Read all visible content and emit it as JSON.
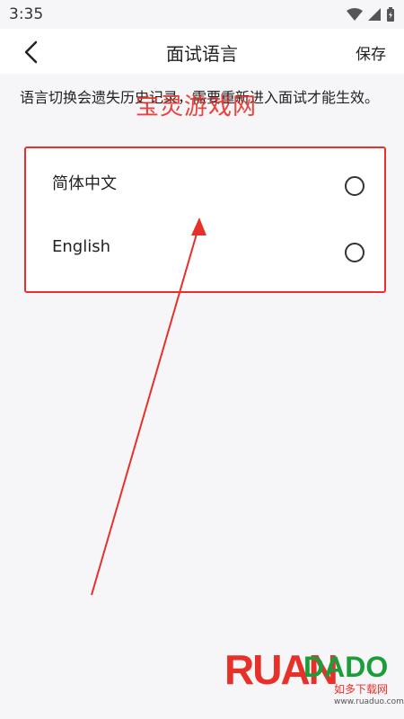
{
  "status_bar": {
    "time": "3:35"
  },
  "header": {
    "title": "面试语言",
    "save_label": "保存"
  },
  "info_text": "语言切换会遗失历史记录，需要重新进入面试才能生效。",
  "options": [
    {
      "label": "简体中文",
      "selected": false
    },
    {
      "label": "English",
      "selected": false
    }
  ],
  "watermark": "宝灵游戏网",
  "logo": {
    "main": "RUAN",
    "secondary": "DADO",
    "sub": "如多下载网",
    "url": "www.ruaduo.com"
  },
  "colors": {
    "accent_red": "#e8302a",
    "background": "#f6f6f8"
  }
}
